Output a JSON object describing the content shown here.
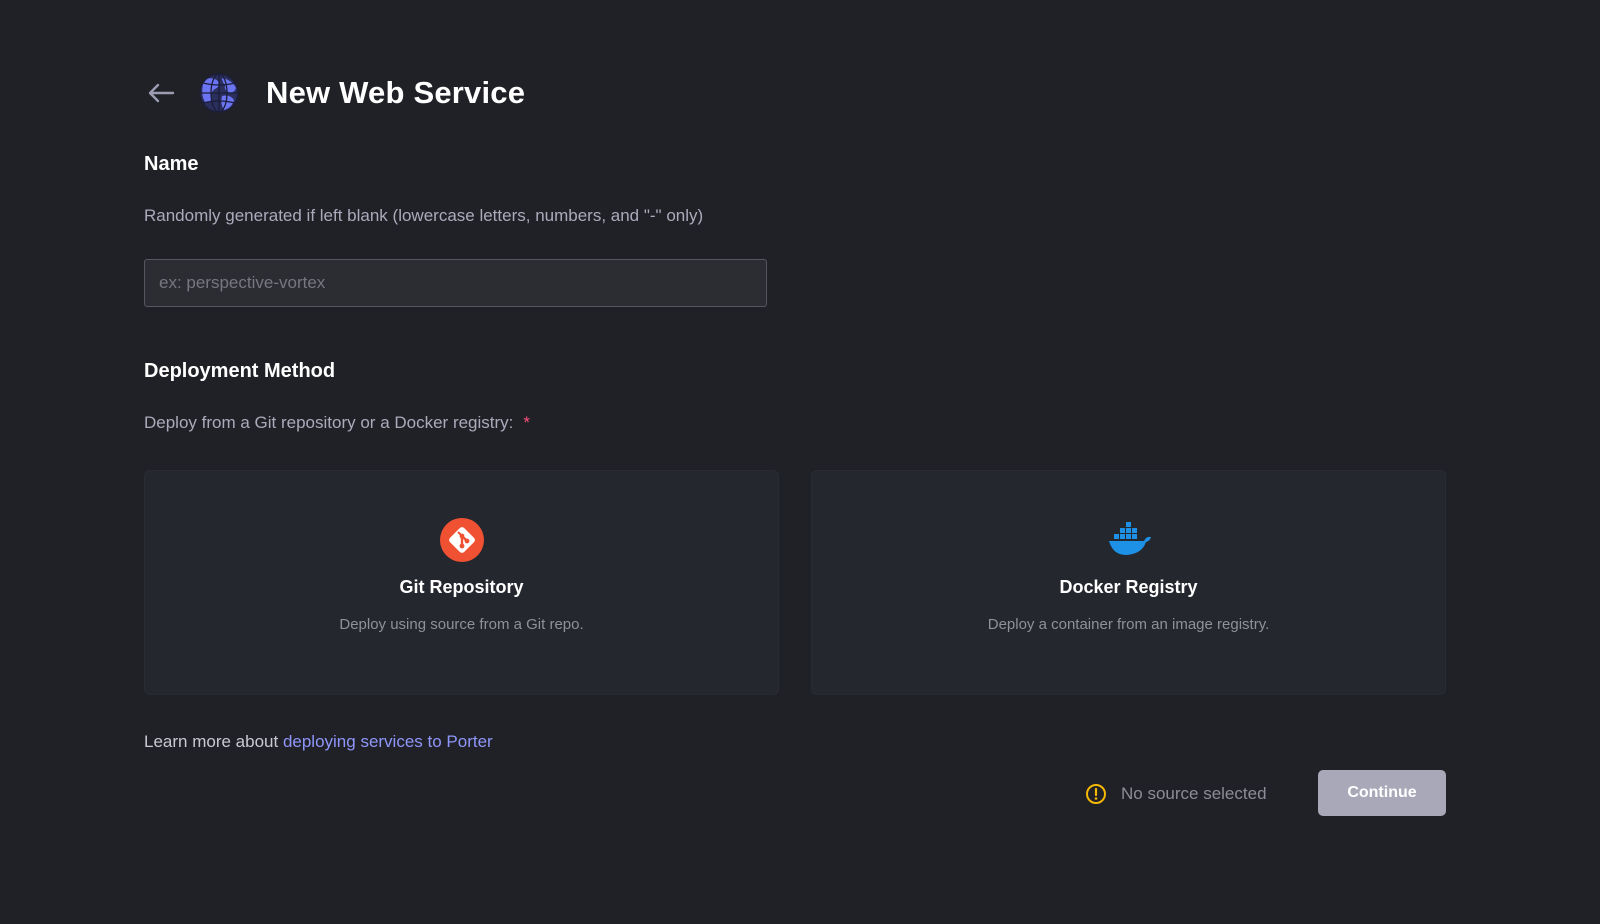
{
  "header": {
    "title": "New Web Service",
    "back_icon": "arrow-left-icon",
    "service_icon": "globe-icon"
  },
  "name_section": {
    "title": "Name",
    "helper": "Randomly generated if left blank (lowercase letters, numbers, and \"-\" only)",
    "input_value": "",
    "input_placeholder": "ex: perspective-vortex"
  },
  "deployment_section": {
    "title": "Deployment Method",
    "helper": "Deploy from a Git repository or a Docker registry:",
    "required_mark": "*",
    "options": [
      {
        "title": "Git Repository",
        "description": "Deploy using source from a Git repo.",
        "icon": "git-icon"
      },
      {
        "title": "Docker Registry",
        "description": "Deploy a container from an image registry.",
        "icon": "docker-icon"
      }
    ]
  },
  "learn_more": {
    "prefix": "Learn more about",
    "link_text": "deploying services to Porter"
  },
  "footer": {
    "status_text": "No source selected",
    "status_icon": "warning-circle-icon",
    "continue_label": "Continue"
  },
  "colors": {
    "background": "#202127",
    "card": "#25272e",
    "link": "#8e96f9",
    "required": "#ff4f7a",
    "warning": "#f5b700",
    "git": "#f05133",
    "docker": "#1d91e6",
    "continue_disabled": "#a9a8b9"
  }
}
